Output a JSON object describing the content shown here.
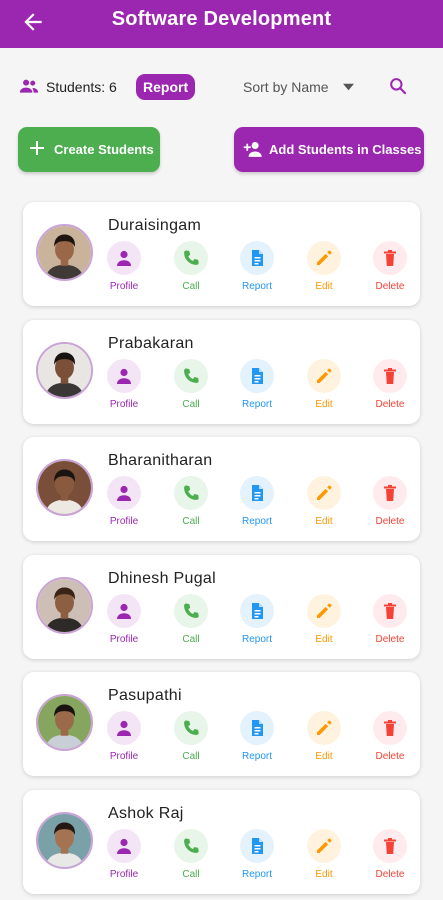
{
  "header": {
    "title": "Software Development"
  },
  "toolbar": {
    "students_count": "Students: 6",
    "report_label": "Report",
    "sort_label": "Sort by Name"
  },
  "buttons": {
    "create_label": "Create Students",
    "add_label": "Add Students in Classes"
  },
  "actions": {
    "profile": "Profile",
    "call": "Call",
    "report": "Report",
    "edit": "Edit",
    "delete": "Delete"
  },
  "colors": {
    "primary": "#9b27b0",
    "green": "#4cae4f",
    "blue": "#2196f3",
    "orange": "#ff9800",
    "red": "#f44336"
  },
  "students": [
    {
      "name": "Duraisingam"
    },
    {
      "name": "Prabakaran"
    },
    {
      "name": "Bharanitharan"
    },
    {
      "name": "Dhinesh Pugal"
    },
    {
      "name": "Pasupathi"
    },
    {
      "name": "Ashok Raj"
    }
  ]
}
